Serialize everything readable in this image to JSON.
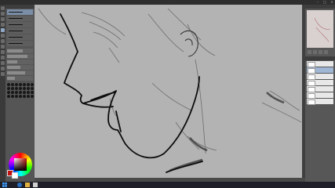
{
  "window": {
    "title": ""
  },
  "panels": {
    "brush_panel_title": "",
    "layer_panel_title": "",
    "navigator_title": ""
  },
  "brushes": [
    {
      "name": ""
    },
    {
      "name": ""
    },
    {
      "name": ""
    },
    {
      "name": ""
    },
    {
      "name": ""
    },
    {
      "name": ""
    }
  ],
  "brush_properties": [
    {
      "level": 0.6
    },
    {
      "level": 0.8
    },
    {
      "level": 0.4
    },
    {
      "level": 0.5
    },
    {
      "level": 0.7
    },
    {
      "level": 0.3
    }
  ],
  "color": {
    "main": "#c01010",
    "sub": "#ffffff"
  },
  "layers": [
    {
      "name": ""
    },
    {
      "name": ""
    },
    {
      "name": ""
    },
    {
      "name": ""
    },
    {
      "name": ""
    },
    {
      "name": ""
    },
    {
      "name": ""
    }
  ],
  "taskbar": {
    "clock": ""
  },
  "icons": {
    "start": "windows-icon",
    "browser": "browser-icon",
    "explorer": "folder-icon",
    "app": "paint-app-icon"
  }
}
